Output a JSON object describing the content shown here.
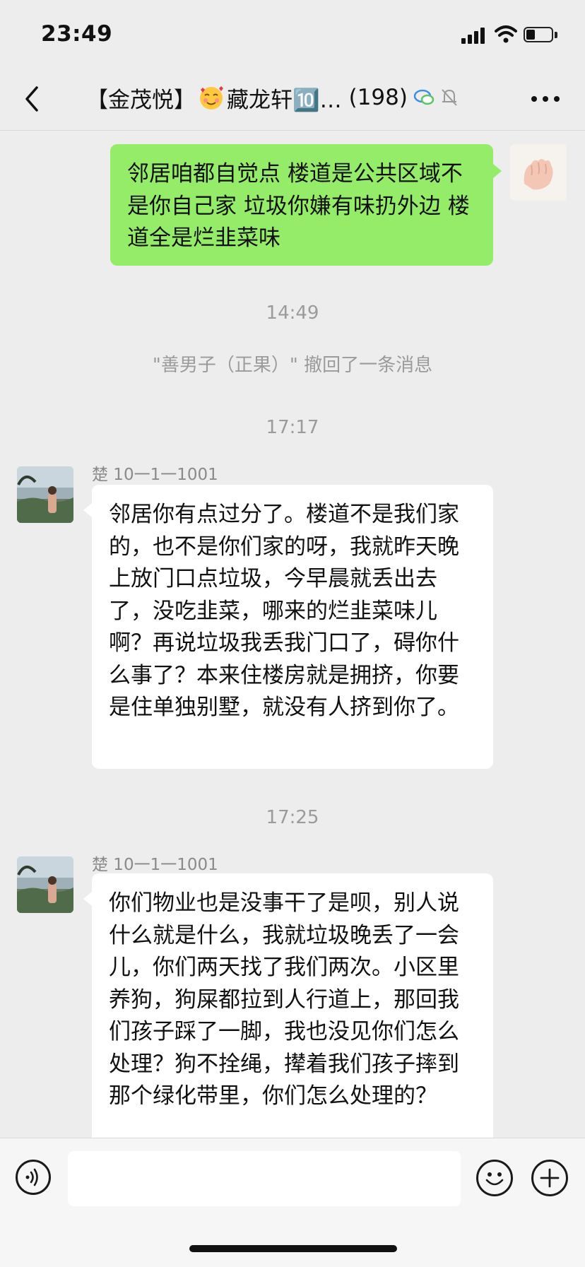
{
  "status_bar": {
    "time": "23:49"
  },
  "nav": {
    "title_prefix": "【金茂悦】",
    "title_main": "藏龙轩🔟…",
    "member_count": "(198)"
  },
  "messages": {
    "m1": {
      "text": "邻居咱都自觉点 楼道是公共区域不是你自己家 垃圾你嫌有味扔外边 楼道全是烂韭菜味"
    },
    "ts1": "14:49",
    "recall": "\"善男子（正果）\" 撤回了一条消息",
    "ts2": "17:17",
    "m2": {
      "sender": "楚 10一1一1001",
      "text": "邻居你有点过分了。楼道不是我们家的，也不是你们家的呀，我就昨天晚上放门口点垃圾，今早晨就丢出去了，没吃韭菜，哪来的烂韭菜味儿啊？再说垃圾我丢我门口了，碍你什么事了？本来住楼房就是拥挤，你要是住单独别墅，就没有人挤到你了。"
    },
    "ts3": "17:25",
    "m3": {
      "sender": "楚 10一1一1001",
      "text": "你们物业也是没事干了是呗，别人说什么就是什么，我就垃圾晚丢了一会儿，你们两天找了我们两次。小区里养狗，狗屎都拉到人行道上，那回我们孩子踩了一脚，我也没见你们怎么处理？狗不拴绳，撵着我们孩子摔到那个绿化带里，你们怎么处理的？"
    }
  },
  "icons": {
    "back": "chevron-left-icon",
    "more": "more-icon",
    "voice": "voice-icon",
    "emoji": "emoji-icon",
    "plus": "plus-icon"
  },
  "colors": {
    "my_bubble": "#95ec69",
    "their_bubble": "#ffffff",
    "background": "#ededed"
  }
}
